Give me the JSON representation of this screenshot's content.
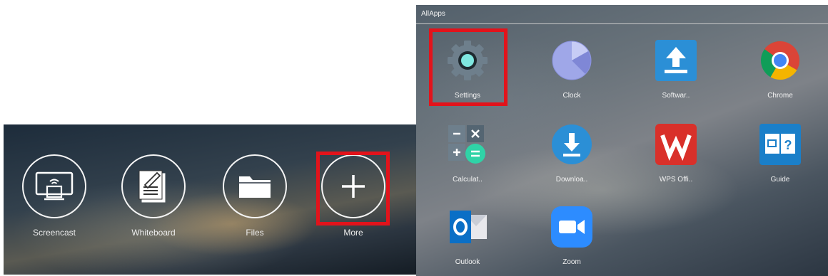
{
  "dock": {
    "items": [
      {
        "label": "Screencast",
        "icon": "screencast-icon"
      },
      {
        "label": "Whiteboard",
        "icon": "whiteboard-icon"
      },
      {
        "label": "Files",
        "icon": "folder-icon"
      },
      {
        "label": "More",
        "icon": "plus-icon"
      }
    ]
  },
  "allapps": {
    "title": "AllApps",
    "apps": [
      {
        "label": "Settings",
        "icon": "settings-gear-icon"
      },
      {
        "label": "Clock",
        "icon": "clock-icon"
      },
      {
        "label": "Softwar..",
        "icon": "software-update-icon"
      },
      {
        "label": "Chrome",
        "icon": "chrome-icon"
      },
      {
        "label": "Calculat..",
        "icon": "calculator-icon"
      },
      {
        "label": "Downloa..",
        "icon": "download-icon"
      },
      {
        "label": "WPS Offi..",
        "icon": "wps-office-icon"
      },
      {
        "label": "Guide",
        "icon": "guide-book-icon"
      },
      {
        "label": "Outlook",
        "icon": "outlook-icon"
      },
      {
        "label": "Zoom",
        "icon": "zoom-icon"
      }
    ]
  },
  "colors": {
    "highlight": "#e2131b",
    "upload_blue": "#2b8fd6",
    "wps_red": "#d9302a",
    "zoom_blue": "#2d8cff",
    "outlook_blue": "#0a6fc6"
  }
}
